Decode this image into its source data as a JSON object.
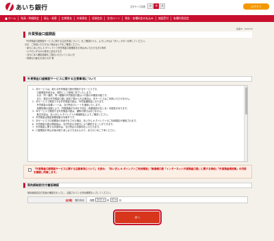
{
  "header": {
    "bank_name": "あいち銀行",
    "font_size_label": "文字サイズ変更",
    "font_sizes": [
      "小",
      "中",
      "大"
    ],
    "logout": "ログオフ"
  },
  "nav": {
    "items": [
      "ホーム",
      "残高・明細照会",
      "振込・振替",
      "定期預金",
      "外貨預金",
      "投資信託",
      "住宅ローン",
      "税金・各種料金の払込み",
      "諸届受付",
      "各種利用設定"
    ]
  },
  "page": {
    "screen_id": "画面ID：BGK010",
    "title": "外貨預金口座開設"
  },
  "intro": {
    "lines": [
      "「外貨預金口座開設サービスに関する注意事項について」をご確認のうえ、よろしければ「次へ」ボタンを押してください。",
      "なお、ご利用いただけない場合は以下をご確認ください。",
      "・新たにあいぎん A ダイレクトで外貨預金口座開設をお申込みいただける方の条件",
      "・以下のいずれかの条件に該当する方",
      "・当行に本人確認書類をご提出いただいていない方",
      "・特殊な口座をお持ちの方 等"
    ]
  },
  "section1": {
    "title": "外貨預金口座開設サービスに関する注意事項について"
  },
  "terms": {
    "lines": [
      "1．本サービスは、新たな外貨預金口座を開設するサービスです。",
      "　　口座開設手続きは、原則として即時に完了いたします。",
      "　　なお、同一通貨、同一種類の外貨預金口座は１口座のみ開設可能です。",
      "　　また、既存の外貨預金口座に追加で預け入れる場合は、本サービスはご利用いただけません。",
      "2．本サービスで開設できる外貨預金口座は、外貨普通預金となります。",
      "　　外貨預金の為替レートは、当行所定のレートを適用いたします。",
      "　　為替相場の変動により、円換算額が元本を下回る（為替差損が生じる）可能性があります。",
      "3．本サービスで開設する外貨預金口座は、通帳の発行はありません。",
      "　　取引内容は、あいぎん A ダイレクトの明細照会によりご確認ください。",
      "4．外貨預金は預金保険制度の対象外です。",
      "5．本サービスで口座開設の手続きをされた場合、あいぎん A ダイレクトのご利用規定が適用されます。",
      "6．外貨預金口座の開設後は、当行所定の手続きにより解約することができます。",
      "7．外貨預金に関する手数料は、当行所定の手数料をいただきます。",
      "8．口座開設お申込み後の取り消しはできませんので、あらかじめご了承ください。"
    ]
  },
  "agree": {
    "text": "「外貨預金口座開設サービスに関する注意事項について」を読み、「あいぎん A ダイレクトご利用規定」「無通帳口座「インターネット外貨預金口座」に関する特約」「外貨預金規定集」の内容を確認し同意します。"
  },
  "section2": {
    "title": "契約締結前交付書面確認"
  },
  "confirm": {
    "note": "契約締結前交付書面の確認日を入力し、記載されている有効期限を入力してください。",
    "required": "【必須】",
    "label": "発行年月",
    "era": "西暦",
    "year_value": "2021",
    "year_unit": "年",
    "month_value": "01",
    "month_unit": "月"
  },
  "next_button": "次へ",
  "colors": {
    "brand_red": "#c8102e",
    "logout_orange": "#f39800",
    "background": "#f4f1ea",
    "agree_bg": "#fcefe6"
  }
}
